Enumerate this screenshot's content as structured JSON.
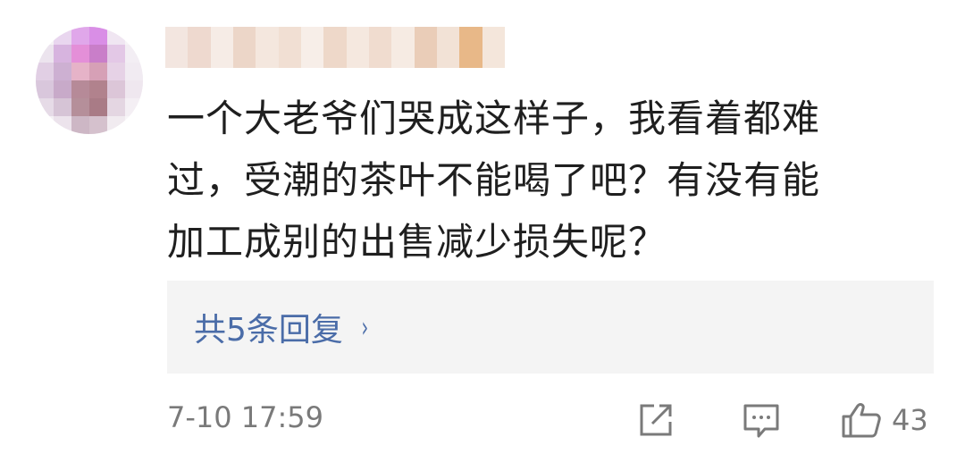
{
  "comment": {
    "lines": [
      "一个大老爷们哭成这样子，我看着都难",
      "过，受潮的茶叶不能喝了吧？有没有能",
      "加工成别的出售减少损失呢？"
    ]
  },
  "replies": {
    "label": "共5条回复",
    "chevron": "›"
  },
  "footer": {
    "timestamp": "7-10 17:59",
    "like_count": "43"
  },
  "icons": {
    "share": "share-icon",
    "comment": "comment-icon",
    "like": "thumbs-up-icon"
  },
  "colors": {
    "link": "#4a6ca8",
    "meta": "#7a7a7a",
    "reply_bg": "#f4f4f4"
  }
}
